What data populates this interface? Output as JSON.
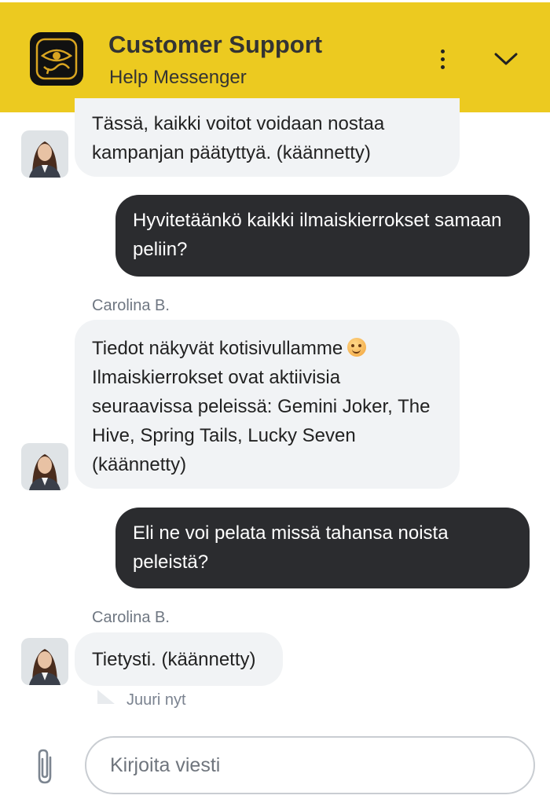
{
  "header": {
    "title": "Customer Support",
    "subtitle": "Help Messenger",
    "background_color": "#ecca20"
  },
  "messages": [
    {
      "type": "incoming",
      "text": "Tässä, kaikki voitot voidaan nostaa kampanjan päätyttyä. (käännetty)"
    },
    {
      "type": "outgoing",
      "text": "Hyvitetäänkö kaikki ilmaiskierrokset samaan peliin?"
    },
    {
      "type": "incoming",
      "sender": "Carolina B.",
      "text_line1": "Tiedot näkyvät kotisivullamme",
      "emoji": "smiling-face-emoji",
      "text_rest": "Ilmaiskierrokset ovat aktiivisia seuraavissa peleissä: Gemini Joker, The Hive, Spring Tails, Lucky Seven (käännetty)"
    },
    {
      "type": "outgoing",
      "text": "Eli ne voi pelata missä tahansa noista peleistä?"
    },
    {
      "type": "incoming",
      "sender": "Carolina B.",
      "text": "Tietysti. (käännetty)",
      "time": "Juuri nyt"
    }
  ],
  "composer": {
    "placeholder": "Kirjoita viesti",
    "attach_icon": "paperclip-icon"
  },
  "colors": {
    "outgoing_bubble": "#2b2c2f",
    "incoming_bubble": "#f1f3f5"
  }
}
